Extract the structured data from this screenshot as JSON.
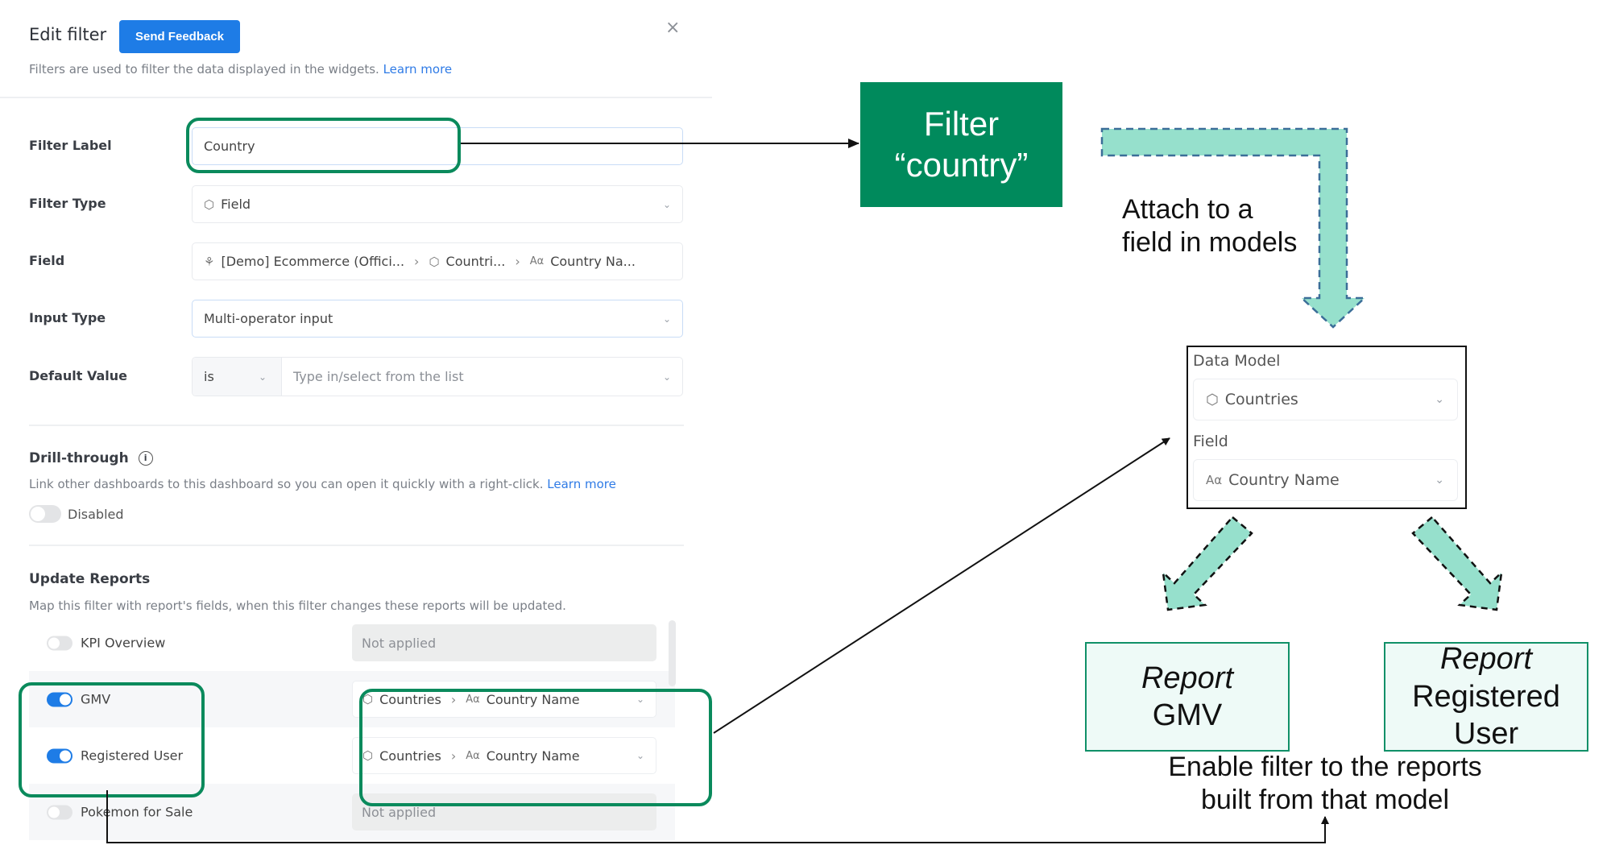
{
  "panel": {
    "title": "Edit filter",
    "feedback_button": "Send Feedback",
    "subtitle": "Filters are used to filter the data displayed in the widgets.",
    "subtitle_link": "Learn more",
    "close_icon": "×",
    "fields": {
      "filter_label": {
        "label": "Filter Label",
        "value": "Country"
      },
      "filter_type": {
        "label": "Filter Type",
        "icon": "cube-icon",
        "value": "Field"
      },
      "field": {
        "label": "Field",
        "path": [
          {
            "icon": "dataset-icon",
            "text": "[Demo] Ecommerce (Offici..."
          },
          {
            "icon": "cube-icon",
            "text": "Countri..."
          },
          {
            "icon": "text-type-icon",
            "text": "Country Na..."
          }
        ]
      },
      "input_type": {
        "label": "Input Type",
        "value": "Multi-operator input"
      },
      "default_value": {
        "label": "Default Value",
        "operator": "is",
        "placeholder": "Type in/select from the list"
      }
    },
    "drill_through": {
      "title": "Drill-through",
      "description": "Link other dashboards to this dashboard so you can open it quickly with a right-click.",
      "link": "Learn more",
      "toggle_label": "Disabled",
      "enabled": false
    },
    "update_reports": {
      "title": "Update Reports",
      "description": "Map this filter with report's fields, when this filter changes these reports will be updated.",
      "reports": [
        {
          "name": "KPI Overview",
          "enabled": false,
          "mapping": "Not applied"
        },
        {
          "name": "GMV",
          "enabled": true,
          "model": "Countries",
          "field": "Country Name"
        },
        {
          "name": "Registered User",
          "enabled": true,
          "model": "Countries",
          "field": "Country Name"
        },
        {
          "name": "Pokemon for Sale",
          "enabled": false,
          "mapping": "Not applied"
        }
      ]
    }
  },
  "diagram": {
    "filter_box": {
      "line1": "Filter",
      "line2": "“country”"
    },
    "attach_note": {
      "line1": "Attach to a",
      "line2": "field in models"
    },
    "model_box": {
      "data_model_label": "Data Model",
      "data_model_value": "Countries",
      "field_label": "Field",
      "field_value": "Country Name"
    },
    "report_gmv": {
      "line1": "Report",
      "line2": "GMV"
    },
    "report_user": {
      "line1": "Report",
      "line2": "Registered",
      "line3": "User"
    },
    "enable_note": {
      "line1": "Enable filter to the reports",
      "line2": "built from that model"
    },
    "colors": {
      "filter_green": "#008a5c",
      "arrow_teal": "#96e0cc",
      "highlight_green": "#0a8a5c",
      "accent_blue": "#1e7ce6"
    }
  },
  "icons": {
    "cube": "⬡",
    "dataset": "⚘",
    "text_type": "Aα",
    "chevron_down": "⌄",
    "chevron_right": "›"
  }
}
